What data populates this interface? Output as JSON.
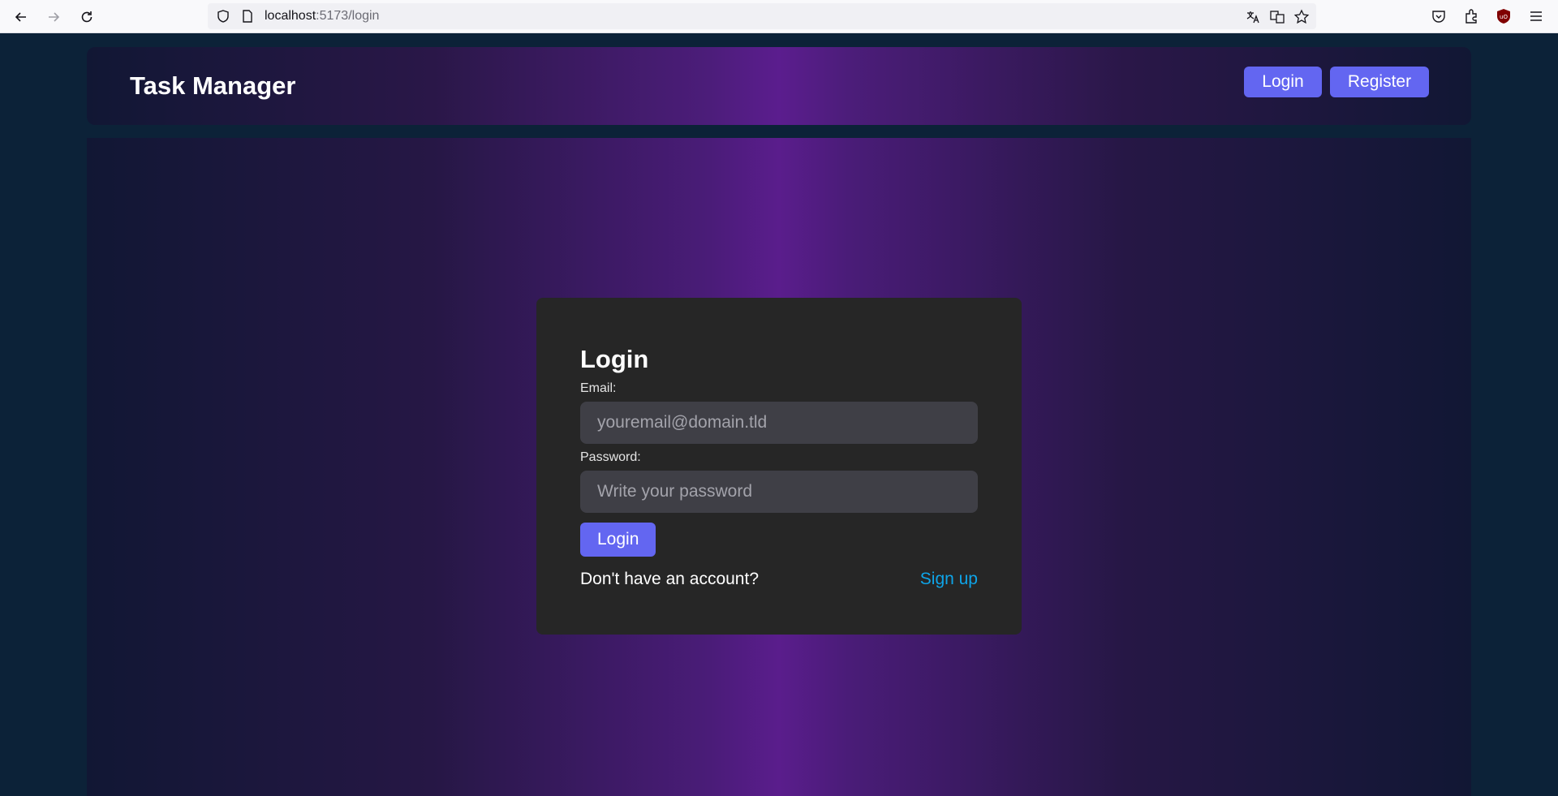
{
  "browser": {
    "url_host": "localhost",
    "url_rest": ":5173/login"
  },
  "header": {
    "brand": "Task Manager",
    "login_label": "Login",
    "register_label": "Register"
  },
  "login_form": {
    "title": "Login",
    "email_label": "Email:",
    "email_placeholder": "youremail@domain.tld",
    "password_label": "Password:",
    "password_placeholder": "Write your password",
    "submit_label": "Login",
    "no_account_text": "Don't have an account?",
    "signup_link": "Sign up"
  },
  "colors": {
    "accent": "#6366f1",
    "link": "#0ea5e9",
    "card_bg": "#262626",
    "page_bg": "#0c2238"
  }
}
